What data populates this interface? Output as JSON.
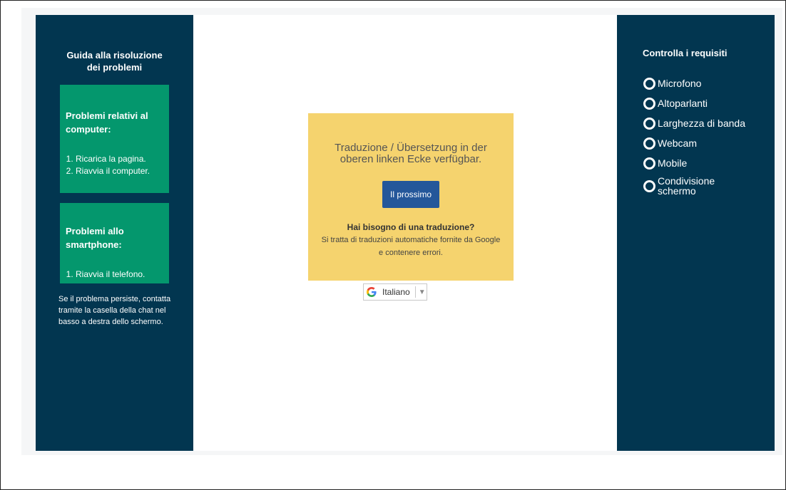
{
  "left_panel": {
    "title": "Guida alla risoluzione dei problemi",
    "computer_card": {
      "title": "Problemi relativi al computer:",
      "steps": [
        "Ricarica la pagina.",
        "Riavvia il computer."
      ]
    },
    "phone_card": {
      "title": "Problemi allo smartphone:",
      "steps": [
        "Riavvia il telefono."
      ]
    },
    "footer": "Se il problema persiste, contatta tramite la casella della chat nel basso a destra dello schermo."
  },
  "translate_box": {
    "message": "Traduzione / Übersetzung in der oberen linken Ecke verfügbar.",
    "next_button": "Il prossimo",
    "question": "Hai bisogno di una traduzione?",
    "note": "Si tratta di traduzioni automatiche fornite da Google e contenere errori.",
    "language_select": {
      "selected": "Italiano",
      "logo": "G"
    }
  },
  "right_panel": {
    "title": "Controlla i requisiti",
    "requirements": [
      "Microfono",
      "Altoparlanti",
      "Larghezza di banda",
      "Webcam",
      "Mobile",
      "Condivisione schermo"
    ]
  },
  "colors": {
    "panel": "#023650",
    "card": "#04976d",
    "translate_box": "#f5d36e",
    "button": "#24579a"
  },
  "icons": {
    "requirement_status": "radio-ring-icon",
    "google": "google-g-icon",
    "dropdown": "triangle-down-icon"
  }
}
